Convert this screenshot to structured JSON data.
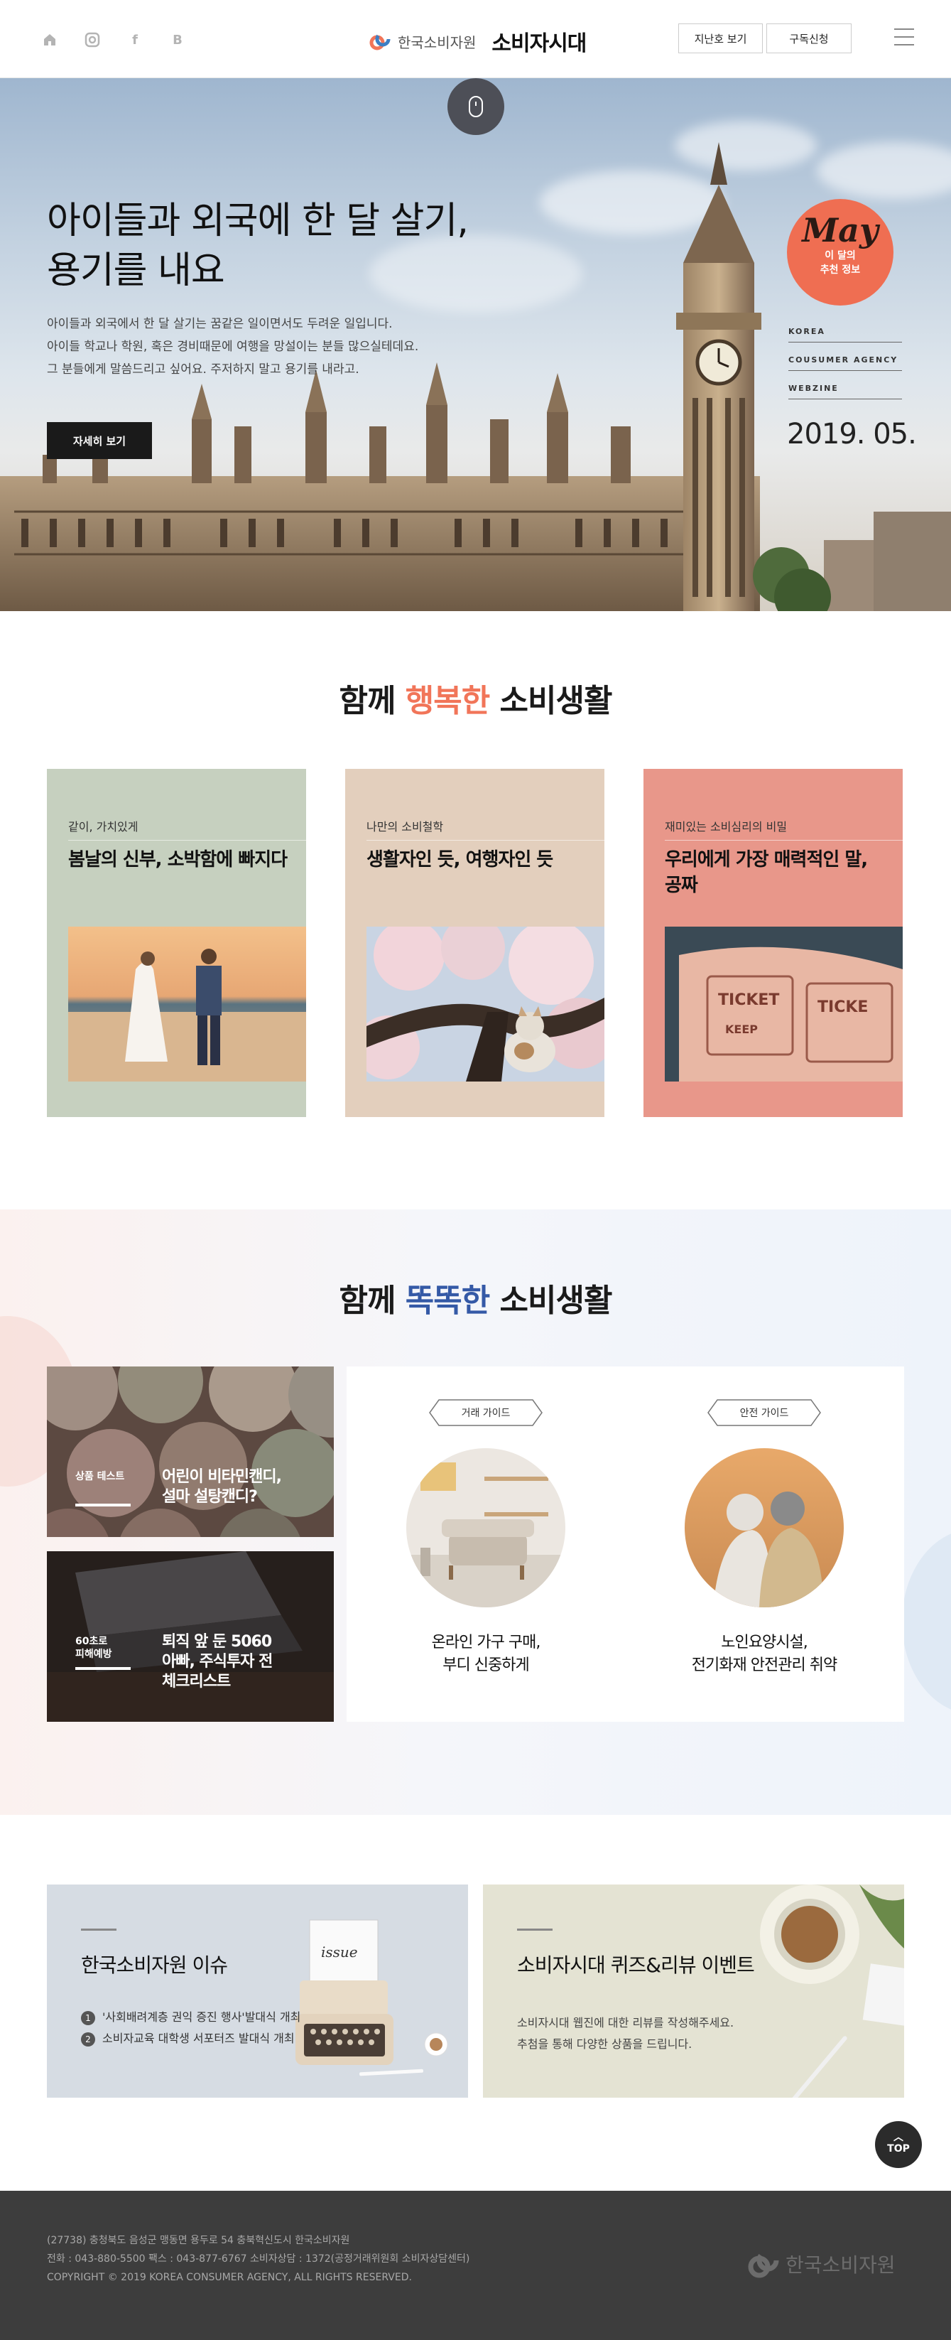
{
  "header": {
    "socials": [
      {
        "icon": "home-icon",
        "label": "home"
      },
      {
        "icon": "instagram-icon",
        "label": "instagram"
      },
      {
        "icon": "facebook-icon",
        "label": "f"
      },
      {
        "icon": "blog-icon",
        "label": "B"
      }
    ],
    "logo_org": "한국소비자원",
    "logo_title": "소비자시대",
    "btn_archive": "지난호 보기",
    "btn_subscribe": "구독신청"
  },
  "hero": {
    "title_line1": "아이들과 외국에 한 달 살기,",
    "title_line2": "용기를 내요",
    "desc_line1": "아이들과 외국에서 한 달 살기는 꿈같은 일이면서도 두려운 일입니다.",
    "desc_line2": "아이들 학교나 학원, 혹은 경비때문에 여행을 망설이는 분들 많으실테데요.",
    "desc_line3": "그 분들에게 말씀드리고 싶어요. 주저하지 말고 용기를 내라고.",
    "button": "자세히 보기",
    "badge_word": "May",
    "badge_sub1": "이 달의",
    "badge_sub2": "추천 정보",
    "meta": [
      "KOREA",
      "COUSUMER AGENCY",
      "WEBZINE"
    ],
    "date": "2019. 05."
  },
  "happy": {
    "title_pre": "함께 ",
    "title_accent": "행복한",
    "title_post": " 소비생활",
    "cards": [
      {
        "category": "같이, 가치있게",
        "title": "봄날의 신부, 소박함에 빠지다",
        "color": "#c6d0bf"
      },
      {
        "category": "나만의 소비철학",
        "title": "생활자인 듯, 여행자인 듯",
        "color": "#e3cfbd"
      },
      {
        "category": "재미있는 소비심리의 비밀",
        "title": "우리에게 가장 매력적인 말, 공짜",
        "color": "#e8978a"
      }
    ]
  },
  "smart": {
    "title_pre": "함께 ",
    "title_accent": "똑똑한",
    "title_post": " 소비생활",
    "tiles": [
      {
        "tag": "상품 테스트",
        "text_line1": "어린이 비타민캔디,",
        "text_line2": "설마 설탕캔디?"
      },
      {
        "tag_line1": "60초로",
        "tag_line2": "피해예방",
        "text_line1": "퇴직 앞 둔 5060",
        "text_line2": "아빠, 주식투자 전",
        "text_line3": "체크리스트"
      }
    ],
    "guides": [
      {
        "tag": "거래 가이드",
        "text_line1": "온라인 가구 구매,",
        "text_line2": "부디 신중하게"
      },
      {
        "tag": "안전 가이드",
        "text_line1": "노인요양시설,",
        "text_line2": "전기화재 안전관리 취약"
      }
    ]
  },
  "banners": {
    "issue": {
      "title": "한국소비자원 이슈",
      "items": [
        {
          "num": "1",
          "text": "'사회배려계층 권익 증진 행사'발대식 개최"
        },
        {
          "num": "2",
          "text": "소비자교육 대학생 서포터즈 발대식 개최"
        }
      ],
      "paper_text": "issue"
    },
    "event": {
      "title": "소비자시대 퀴즈&리뷰 이벤트",
      "desc_line1": "소비자시대 웹진에 대한 리뷰를 작성해주세요.",
      "desc_line2": "추첨을 통해 다양한 상품을 드립니다."
    }
  },
  "top_button": "TOP",
  "footer": {
    "address": "(27738) 충청북도 음성군 맹동면 용두로 54 충북혁신도시 한국소비자원",
    "contact": "전화 : 043-880-5500     팩스 : 043-877-6767     소비자상담 : 1372(공정거래위원회 소비자상담센터)",
    "copyright": "COPYRIGHT © 2019 KOREA CONSUMER AGENCY, ALL RIGHTS RESERVED.",
    "logo": "한국소비자원"
  },
  "colors": {
    "accent_orange": "#f17559",
    "accent_blue": "#3459a6",
    "footer_bg": "#3d3d3d"
  }
}
